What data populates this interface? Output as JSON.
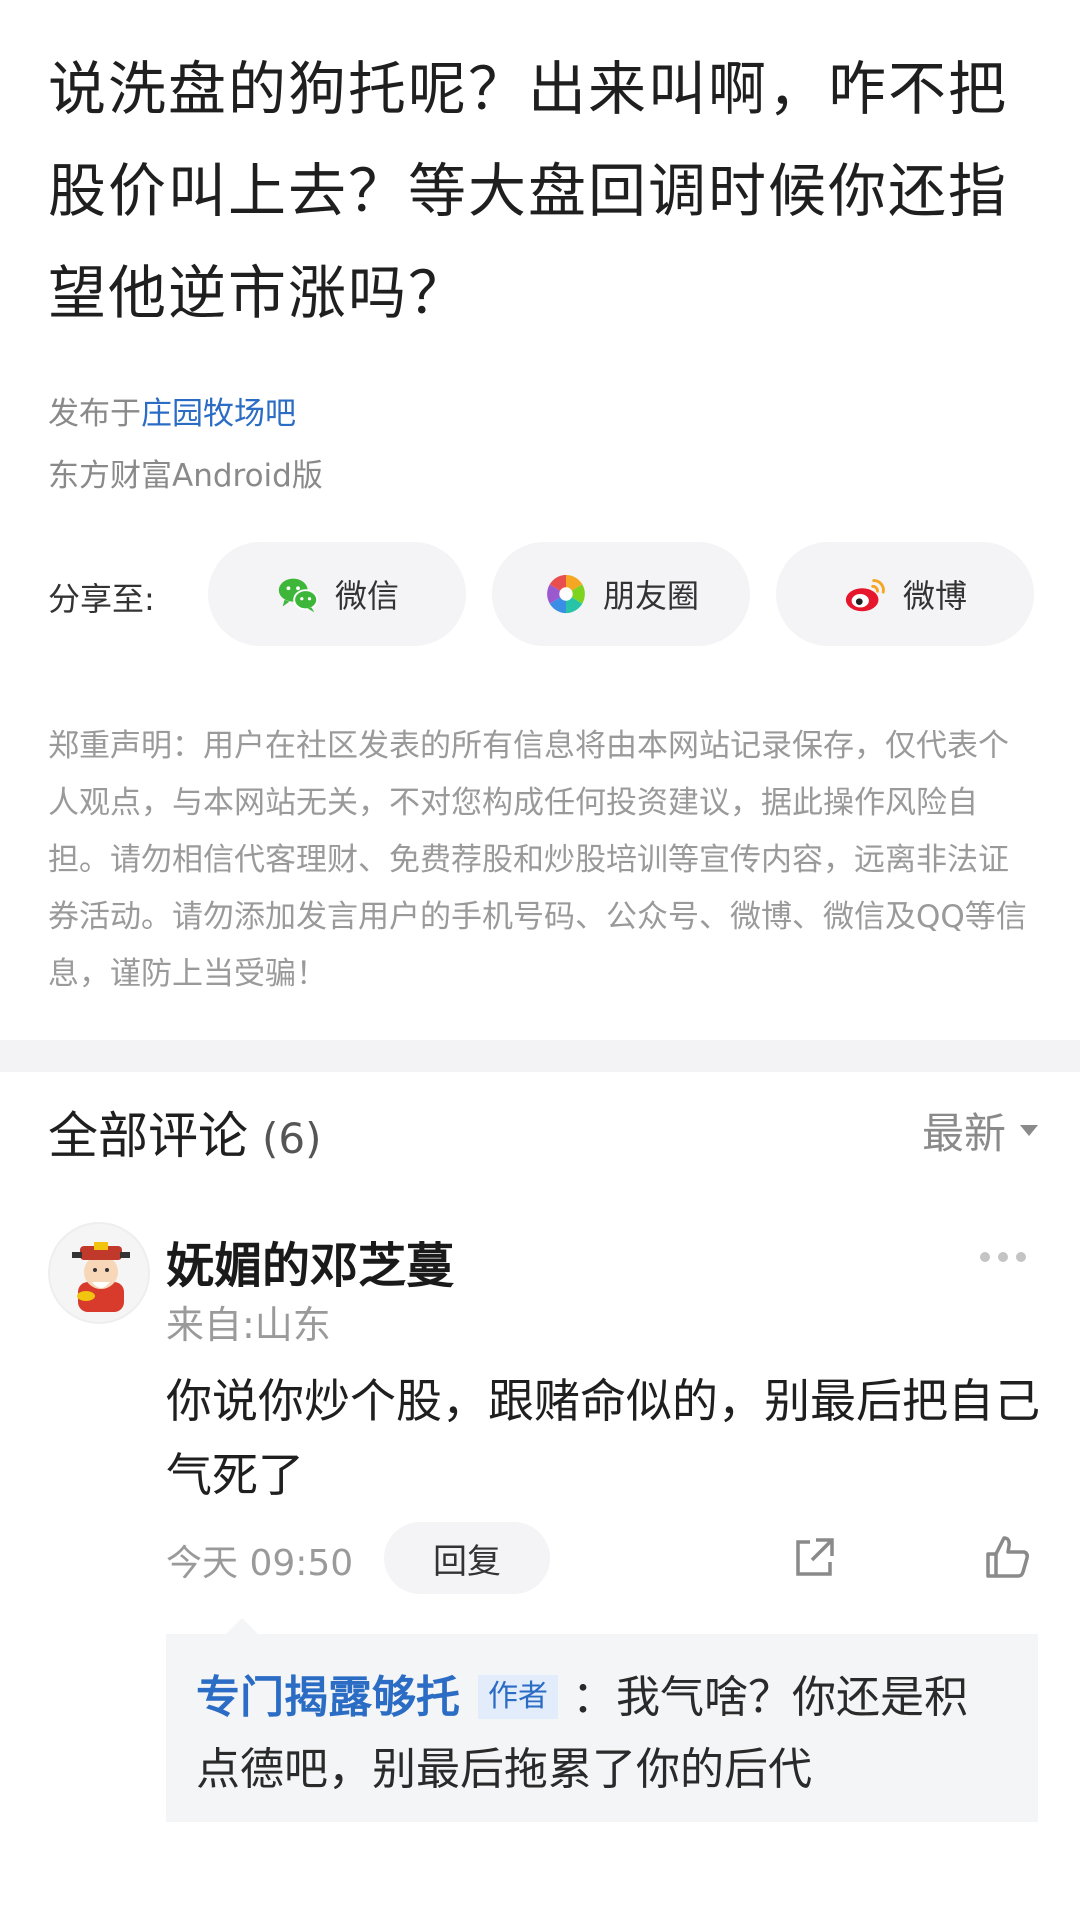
{
  "post": {
    "title": "说洗盘的狗托呢？出来叫啊，咋不把股价叫上去？等大盘回调时候你还指望他逆市涨吗？",
    "forum_prefix": "发布于",
    "forum_name": "庄园牧场吧",
    "client": "东方财富Android版"
  },
  "share": {
    "label": "分享至:",
    "wechat": "微信",
    "moments": "朋友圈",
    "weibo": "微博"
  },
  "disclaimer": "郑重声明：用户在社区发表的所有信息将由本网站记录保存，仅代表个人观点，与本网站无关，不对您构成任何投资建议，据此操作风险自担。请勿相信代客理财、免费荐股和炒股培训等宣传内容，远离非法证券活动。请勿添加发言用户的手机号码、公众号、微博、微信及QQ等信息，谨防上当受骗！",
  "comments": {
    "title": "全部评论",
    "count": "(6)",
    "sort": "最新",
    "items": [
      {
        "author": "妩媚的邓芝蔓",
        "location": "来自:山东",
        "body": "你说你炒个股，跟赌命似的，别最后把自己气死了",
        "time": "今天  09:50",
        "reply_label": "回复",
        "reply": {
          "author": "专门揭露够托",
          "badge": "作者",
          "separator": "：",
          "text": "我气啥？你还是积点德吧，别最后拖累了你的后代"
        }
      }
    ]
  },
  "colors": {
    "link": "#2b6cc4",
    "muted": "#9a9a9a",
    "panel": "#f4f5f7"
  }
}
